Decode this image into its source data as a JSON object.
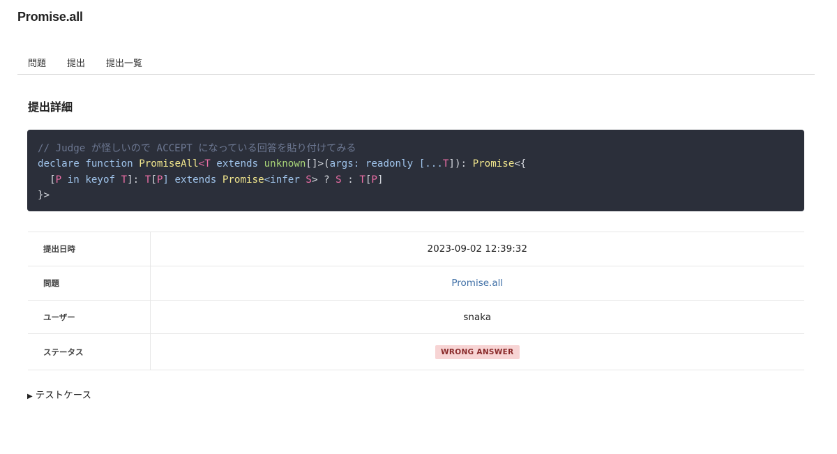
{
  "app": {
    "title": "Promise.all"
  },
  "tabs": [
    {
      "label": "問題"
    },
    {
      "label": "提出"
    },
    {
      "label": "提出一覧"
    }
  ],
  "section": {
    "title": "提出詳細"
  },
  "code": {
    "line1": "// Judge が怪しいので ACCEPT になっている回答を貼り付けてみる",
    "line2": {
      "t1": "declare function ",
      "t2": "PromiseAll",
      "t3": "<",
      "t4": "T",
      "t5": " extends ",
      "t6": "unknown",
      "t7": "[]>(",
      "t8": "args",
      "t9": ": readonly [...",
      "t10": "T",
      "t11": "]): ",
      "t12": "Promise",
      "t13": "<{"
    },
    "line3": {
      "t1": "  [",
      "t2": "P",
      "t3": " in keyof ",
      "t4": "T",
      "t5": "]: ",
      "t6": "T",
      "t7": "[",
      "t8": "P",
      "t9": "] extends ",
      "t10": "Promise",
      "t11": "<infer ",
      "t12": "S",
      "t13": "> ? ",
      "t14": "S",
      "t15": " : ",
      "t16": "T",
      "t17": "[",
      "t18": "P",
      "t19": "]"
    },
    "line4": "}>"
  },
  "details": {
    "rows": [
      {
        "label": "提出日時",
        "value": "2023-09-02 12:39:32"
      },
      {
        "label": "問題",
        "value": "Promise.all"
      },
      {
        "label": "ユーザー",
        "value": "snaka"
      },
      {
        "label": "ステータス",
        "value": "WRONG ANSWER"
      }
    ]
  },
  "testcases": {
    "toggle_icon": "▶",
    "label": "テストケース"
  },
  "colors": {
    "code_bg": "#2b2f3a",
    "link": "#3f6fa6",
    "badge_bg": "#f7d4d4",
    "badge_text": "#8a2b2b"
  }
}
